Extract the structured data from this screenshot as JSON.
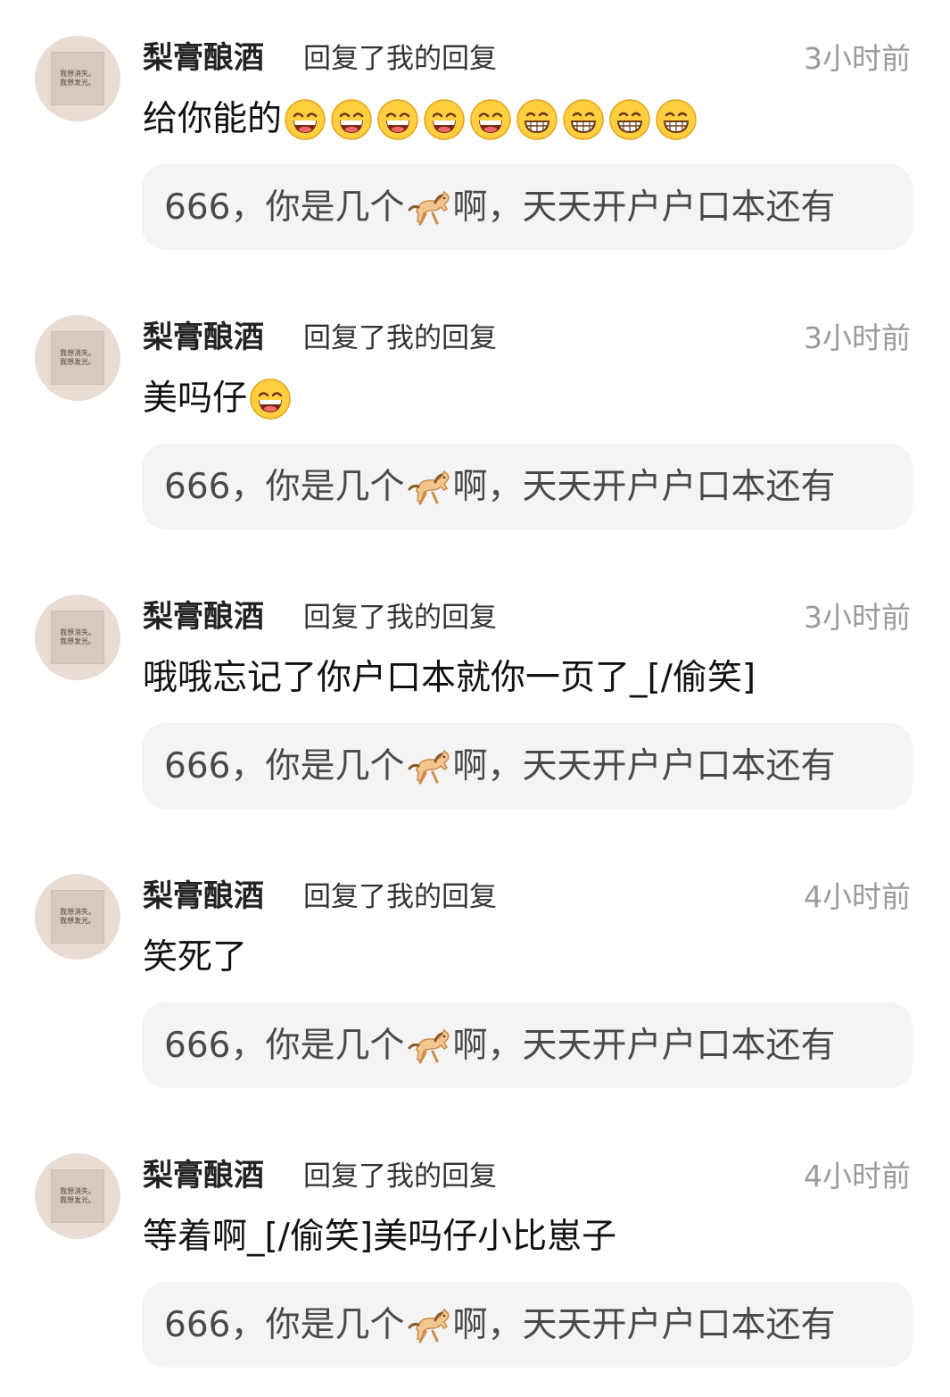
{
  "avatar_text": "我想消失。\n我想发光。",
  "comments": [
    {
      "username": "梨膏酿酒",
      "action": "回复了我的回复",
      "time": "3小时前",
      "reply_text": "给你能的",
      "emojis": [
        "grinning-face-with-smiling-eyes",
        "grinning-face-with-smiling-eyes",
        "grinning-face-with-smiling-eyes",
        "grinning-face-with-smiling-eyes",
        "grinning-face-with-smiling-eyes",
        "beaming-face",
        "beaming-face",
        "beaming-face",
        "beaming-face"
      ],
      "quote_prefix": "666，你是几个",
      "quote_icon": "horse-icon",
      "quote_suffix": "啊，天天开户户口本还有"
    },
    {
      "username": "梨膏酿酒",
      "action": "回复了我的回复",
      "time": "3小时前",
      "reply_text": "美吗仔",
      "emojis": [
        "grinning-face-with-smiling-eyes"
      ],
      "quote_prefix": "666，你是几个",
      "quote_icon": "horse-icon",
      "quote_suffix": "啊，天天开户户口本还有"
    },
    {
      "username": "梨膏酿酒",
      "action": "回复了我的回复",
      "time": "3小时前",
      "reply_text": "哦哦忘记了你户口本就你一页了_[/偷笑]",
      "emojis": [],
      "quote_prefix": "666，你是几个",
      "quote_icon": "horse-icon",
      "quote_suffix": "啊，天天开户户口本还有"
    },
    {
      "username": "梨膏酿酒",
      "action": "回复了我的回复",
      "time": "4小时前",
      "reply_text": "笑死了",
      "emojis": [],
      "quote_prefix": "666，你是几个",
      "quote_icon": "horse-icon",
      "quote_suffix": "啊，天天开户户口本还有"
    },
    {
      "username": "梨膏酿酒",
      "action": "回复了我的回复",
      "time": "4小时前",
      "reply_text": "等着啊_[/偷笑]美吗仔小比崽子",
      "emojis": [],
      "quote_prefix": "666，你是几个",
      "quote_icon": "horse-icon",
      "quote_suffix": "啊，天天开户户口本还有"
    }
  ]
}
